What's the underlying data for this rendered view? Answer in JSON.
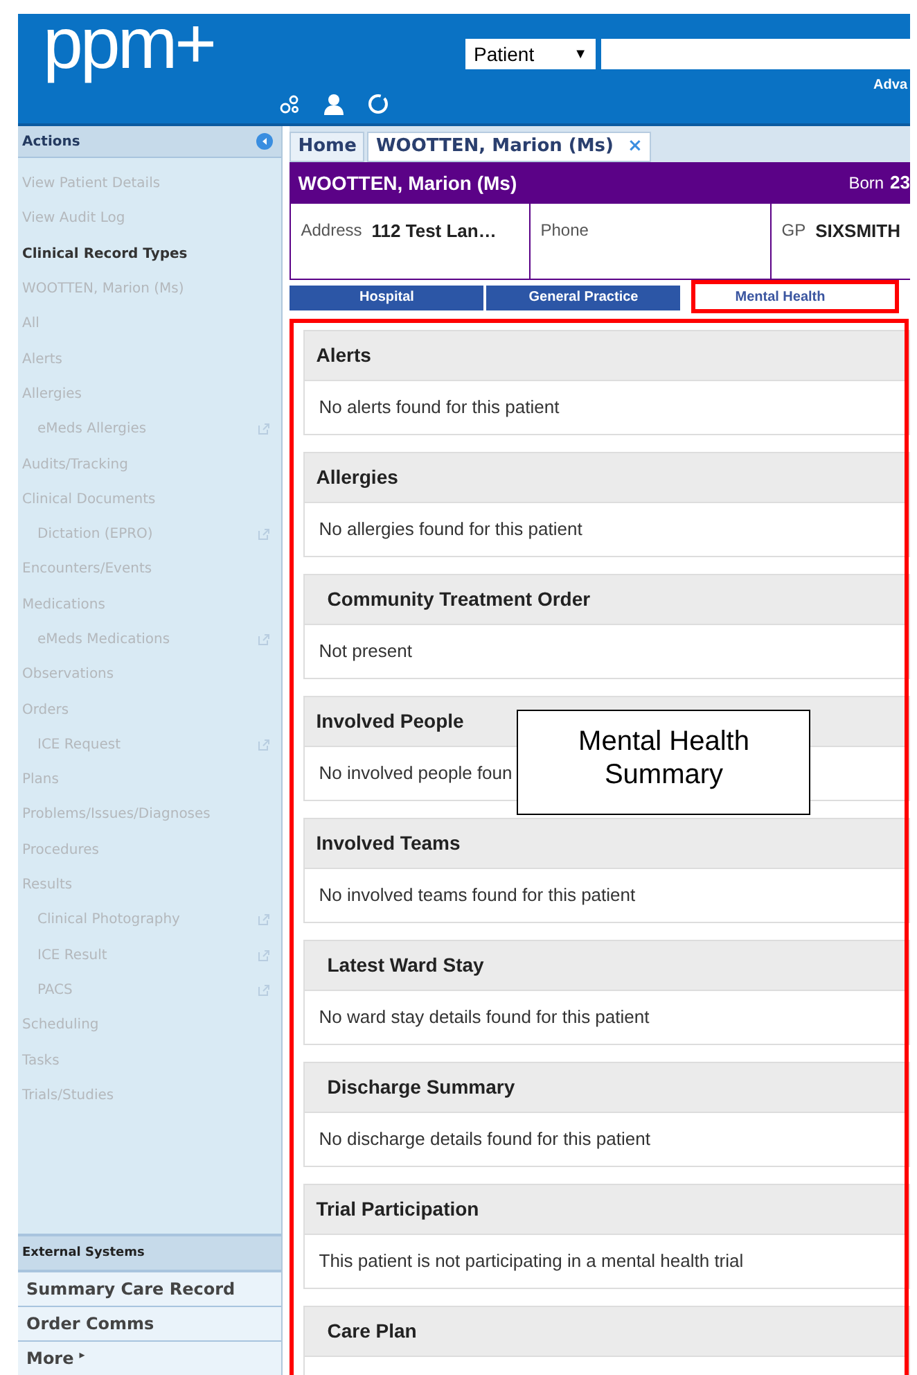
{
  "header": {
    "logo": "ppm+",
    "search_type": "Patient",
    "dropdown_caret": "▼",
    "advanced_link": "Adva"
  },
  "sidebar": {
    "title": "Actions",
    "items": [
      {
        "label": "View Patient Details",
        "kind": "item",
        "external": false
      },
      {
        "label": "View Audit Log",
        "kind": "item",
        "external": false
      },
      {
        "label": "Clinical Record Types",
        "kind": "heading",
        "external": false
      },
      {
        "label": "WOOTTEN, Marion (Ms)",
        "kind": "item",
        "external": false
      },
      {
        "label": "All",
        "kind": "item",
        "external": false
      },
      {
        "label": "Alerts",
        "kind": "item",
        "external": false
      },
      {
        "label": "Allergies",
        "kind": "item",
        "external": false
      },
      {
        "label": "eMeds Allergies",
        "kind": "subitem",
        "external": true
      },
      {
        "label": "Audits/Tracking",
        "kind": "item",
        "external": false
      },
      {
        "label": "Clinical Documents",
        "kind": "item",
        "external": false
      },
      {
        "label": "Dictation (EPRO)",
        "kind": "subitem",
        "external": true
      },
      {
        "label": "Encounters/Events",
        "kind": "item",
        "external": false
      },
      {
        "label": "Medications",
        "kind": "item",
        "external": false
      },
      {
        "label": "eMeds Medications",
        "kind": "subitem",
        "external": true
      },
      {
        "label": "Observations",
        "kind": "item",
        "external": false
      },
      {
        "label": "Orders",
        "kind": "item",
        "external": false
      },
      {
        "label": "ICE Request",
        "kind": "subitem",
        "external": true
      },
      {
        "label": "Plans",
        "kind": "item",
        "external": false
      },
      {
        "label": "Problems/Issues/Diagnoses",
        "kind": "item",
        "external": false
      },
      {
        "label": "Procedures",
        "kind": "item",
        "external": false
      },
      {
        "label": "Results",
        "kind": "item",
        "external": false
      },
      {
        "label": "Clinical Photography",
        "kind": "subitem",
        "external": true
      },
      {
        "label": "ICE Result",
        "kind": "subitem",
        "external": true
      },
      {
        "label": "PACS",
        "kind": "subitem",
        "external": true
      },
      {
        "label": "Scheduling",
        "kind": "item",
        "external": false
      },
      {
        "label": "Tasks",
        "kind": "item",
        "external": false
      },
      {
        "label": "Trials/Studies",
        "kind": "item",
        "external": false
      }
    ],
    "external_title": "External Systems",
    "external_links": [
      {
        "label": "Summary Care Record"
      },
      {
        "label": "Order Comms"
      },
      {
        "label": "More",
        "arrow": "▸"
      }
    ]
  },
  "page_tabs": [
    {
      "label": "Home",
      "selected": false
    },
    {
      "label": "WOOTTEN, Marion (Ms)",
      "selected": true,
      "close": "×"
    }
  ],
  "patient": {
    "name": "WOOTTEN, Marion (Ms)",
    "born_label": "Born",
    "born_value": "23",
    "fields": [
      {
        "label": "Address",
        "value": "112 Test Lan…"
      },
      {
        "label": "Phone"
      },
      {
        "label": "GP",
        "value": "SIXSMITH"
      }
    ]
  },
  "record_tabs": [
    {
      "label": "Hospital",
      "selected": false
    },
    {
      "label": "General Practice",
      "selected": false
    },
    {
      "label": "Mental Health",
      "selected": true
    }
  ],
  "sections": [
    {
      "title": "Alerts",
      "body": "No alerts found for this patient",
      "indented": false
    },
    {
      "title": "Allergies",
      "body": "No allergies found for this patient",
      "indented": false
    },
    {
      "title": "Community Treatment Order",
      "body": "Not present",
      "indented": true
    },
    {
      "title": "Involved People",
      "body": "No involved people foun",
      "indented": false
    },
    {
      "title": "Involved Teams",
      "body": "No involved teams found for this patient",
      "indented": false
    },
    {
      "title": "Latest Ward Stay",
      "body": "No ward stay details found for this patient",
      "indented": true
    },
    {
      "title": "Discharge Summary",
      "body": "No discharge details found for this patient",
      "indented": true
    },
    {
      "title": "Trial Participation",
      "body": "This patient is not participating in a mental health trial",
      "indented": false
    },
    {
      "title": "Care Plan",
      "indented": true
    }
  ],
  "callout": "Mental Health Summary"
}
